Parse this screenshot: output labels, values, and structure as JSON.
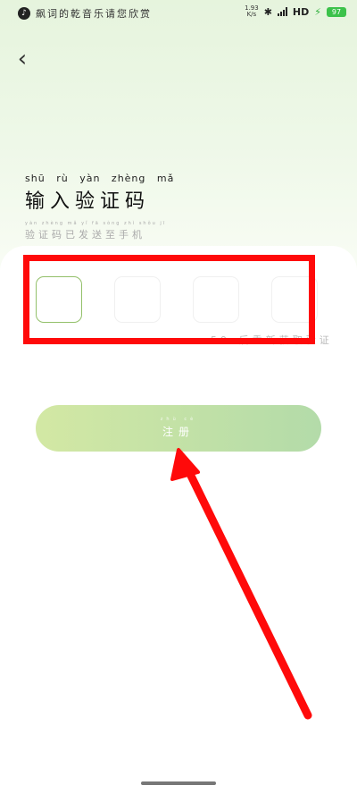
{
  "status_bar": {
    "app_text": "飙词的乾音乐请您欣赏",
    "speed_value": "1.93",
    "speed_unit": "K/s",
    "network": "HD",
    "battery": "97"
  },
  "header": {
    "back_icon": "chevron-left-icon"
  },
  "title": {
    "pinyin": [
      "shū",
      "rù",
      "yàn",
      "zhèng",
      "mǎ"
    ],
    "text": "输入验证码",
    "subtitle_pinyin": "yàn zhèng mǎ yǐ fā sòng zhì shǒu jī",
    "subtitle": "验证码已发送至手机"
  },
  "code_input": {
    "boxes": [
      "",
      "",
      "",
      ""
    ],
    "resend_text": "59s后重新获取验证"
  },
  "register_button": {
    "pinyin": "zhù cè",
    "label": "注册"
  },
  "annotation": {
    "highlight_color": "#ff0a0a",
    "arrow_color": "#ff0a0a"
  }
}
